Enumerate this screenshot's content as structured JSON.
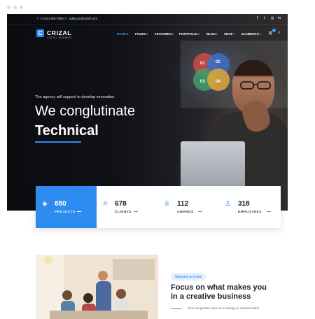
{
  "topbar": {
    "phone": "(+123) 456-7890",
    "email": "adkyour@email.com",
    "social_icons": [
      "facebook-icon",
      "twitter-icon",
      "instagram-icon",
      "linkedin-icon"
    ]
  },
  "brand": {
    "name": "CRIZAL",
    "tagline": "FOR ALL BUSINESS",
    "mark": "C"
  },
  "nav": {
    "items": [
      {
        "label": "HOME",
        "active": true
      },
      {
        "label": "PAGES"
      },
      {
        "label": "FEATURES"
      },
      {
        "label": "PORTFOLIO"
      },
      {
        "label": "BLOG"
      },
      {
        "label": "SHOP"
      },
      {
        "label": "ELEMENTS"
      }
    ],
    "cart_count": "0"
  },
  "hero": {
    "tagline": "The agency will support to develop innovation.",
    "heading_line1": "We conglutinate",
    "heading_line2": "Technical",
    "board_numbers": [
      "01",
      "02",
      "03",
      "04"
    ]
  },
  "stats": [
    {
      "value": "880",
      "label": "PROJECTS",
      "icon": "layers-icon"
    },
    {
      "value": "678",
      "label": "CLIENTS",
      "icon": "atom-icon"
    },
    {
      "value": "112",
      "label": "AWARDS",
      "icon": "trophy-icon"
    },
    {
      "value": "318",
      "label": "EMPLOYEES",
      "icon": "user-icon"
    }
  ],
  "about": {
    "badge": "Welcome to Crizal",
    "title_line1": "Focus on what makes you",
    "title_line2": "in a creative business",
    "text": "Duis integration aute mure design in reprehenderit"
  },
  "colors": {
    "accent": "#2d8cf0",
    "dark": "#1b1e27"
  }
}
